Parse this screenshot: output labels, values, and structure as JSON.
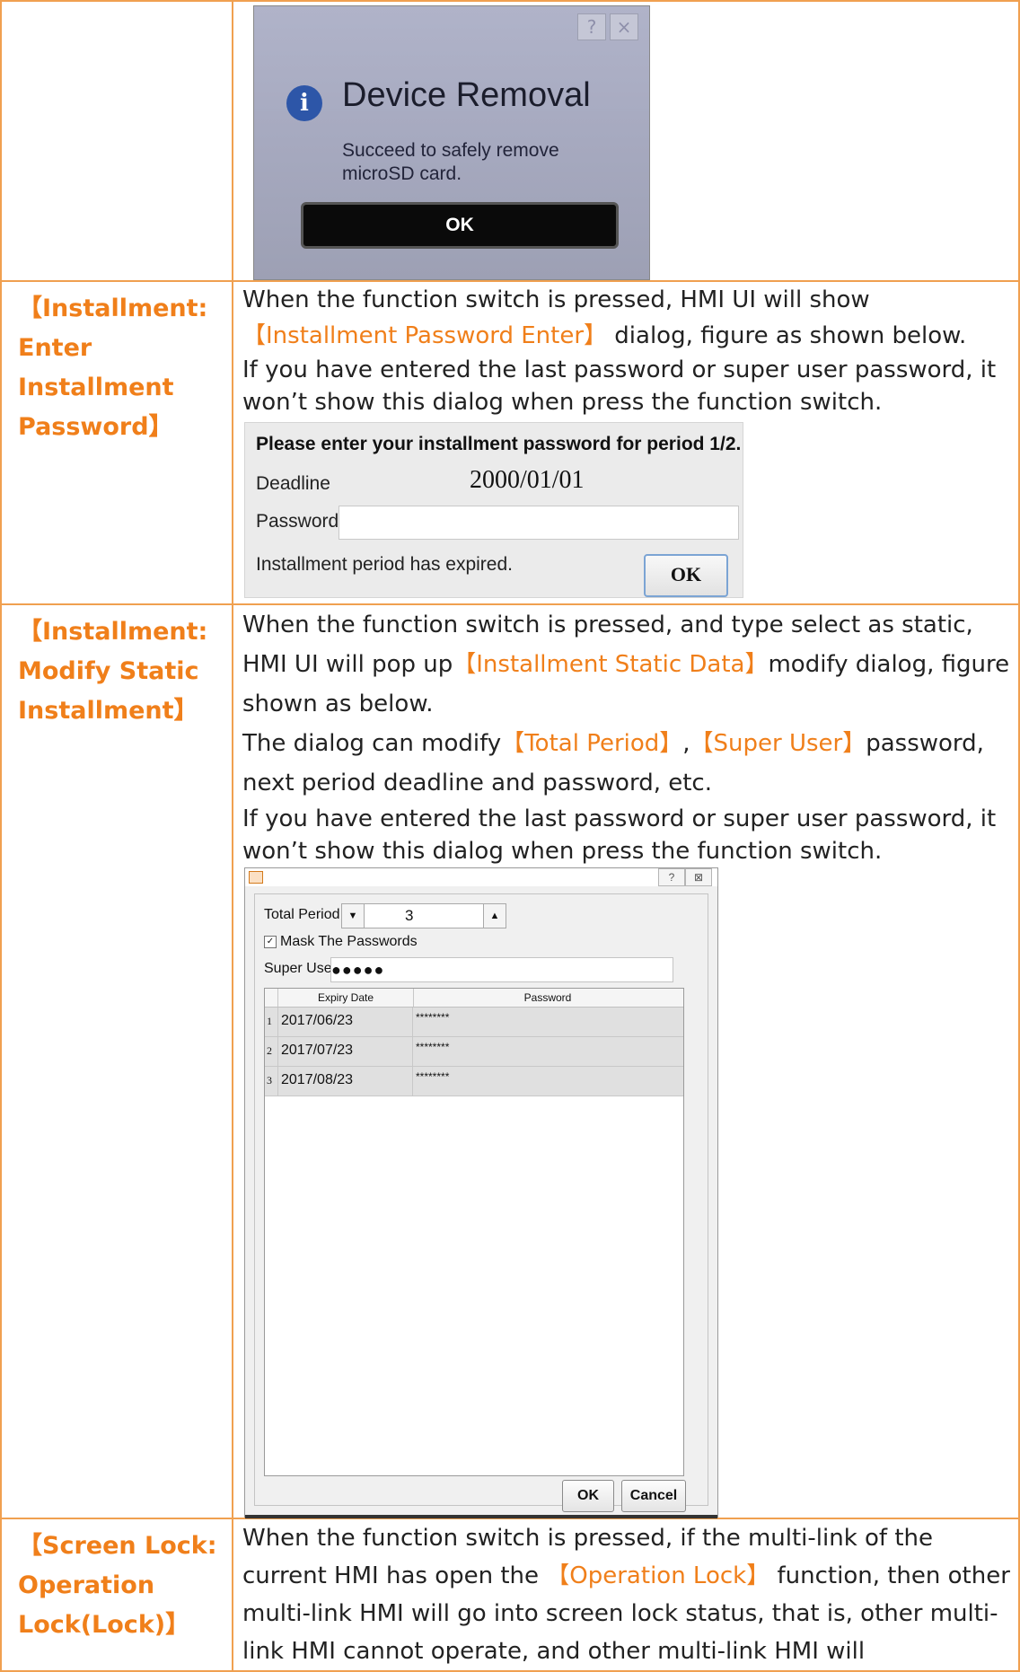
{
  "row1": {
    "dialog": {
      "title": "Device Removal",
      "help_glyph": "?",
      "close_glyph": "×",
      "message_line1": "Succeed to safely remove",
      "message_line2": "microSD card.",
      "ok_label": "OK"
    }
  },
  "row2": {
    "label_line1": "【Installment:",
    "label_line2": "Enter",
    "label_line3": "Installment",
    "label_line4": "Password】",
    "p1_a": "When the function switch is pressed, HMI UI will show",
    "p1_hl": "【Installment Password Enter】",
    "p1_b": " dialog, figure as shown below.",
    "p2": "If you have entered the last password or super user password, it won’t show this dialog when press the function switch.",
    "dialog": {
      "title": "Please enter your installment password for period 1/2.",
      "deadline_label": "Deadline",
      "deadline_value": "2000/01/01",
      "password_label": "Password",
      "password_value": "",
      "status": "Installment period has expired.",
      "ok_label": "OK"
    }
  },
  "row3": {
    "label_line1": "【Installment:",
    "label_line2": "Modify Static",
    "label_line3": "Installment】",
    "p1_a": "When the function switch is pressed, and type select as static, HMI UI will pop up",
    "p1_hl": "【Installment Static Data】",
    "p1_b": "modify dialog, figure shown as below.",
    "p2_a": "The dialog can modify",
    "p2_hl1": "【Total Period】",
    "p2_comma": ",",
    "p2_hl2": "【Super User】",
    "p2_b": "password, next period deadline and password, etc.",
    "p3": "If you have entered the last password or super user password, it won’t show this dialog when press the function switch.",
    "dialog": {
      "help_glyph": "?",
      "close_glyph": "⊠",
      "total_period_label": "Total Period",
      "total_period_value": "3",
      "mask_label": "Mask The Passwords",
      "mask_checked": true,
      "super_user_label": "Super User",
      "super_user_value": "●●●●●",
      "col_expiry": "Expiry Date",
      "col_password": "Password",
      "rows": [
        {
          "num": "1",
          "date": "2017/06/23",
          "password": "********"
        },
        {
          "num": "2",
          "date": "2017/07/23",
          "password": "********"
        },
        {
          "num": "3",
          "date": "2017/08/23",
          "password": "********"
        }
      ],
      "ok_label": "OK",
      "cancel_label": "Cancel"
    }
  },
  "row4": {
    "label_line1": "【Screen Lock:",
    "label_line2": "Operation",
    "label_line3": "Lock(Lock)】",
    "t1": "When the function switch is pressed, if the multi-link of the current HMI has open the",
    "t1_hl": "【Operation Lock】",
    "t1_b": " function, then other multi-link HMI will go into screen lock status, that is, other multi-link HMI cannot operate, and other multi-link HMI will"
  }
}
